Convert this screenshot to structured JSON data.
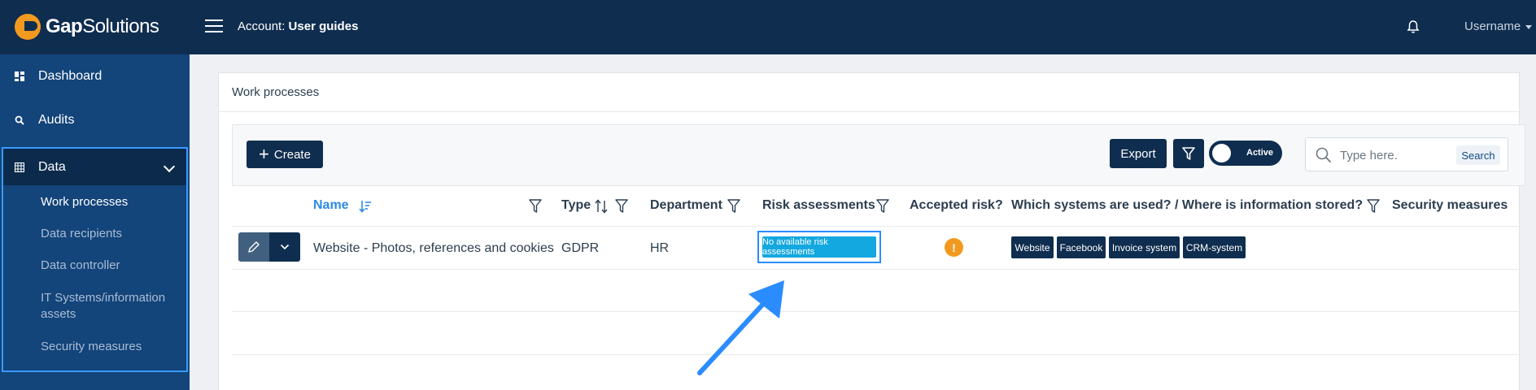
{
  "app": {
    "logo_text_bold": "Gap",
    "logo_text": "Solutions"
  },
  "header": {
    "account_label": "Account:",
    "account_name": "User guides",
    "username": "Username"
  },
  "sidebar": {
    "items": [
      {
        "label": "Dashboard",
        "icon": "dashboard-icon"
      },
      {
        "label": "Audits",
        "icon": "search-icon"
      },
      {
        "label": "Data",
        "icon": "table-icon"
      }
    ],
    "data_subitems": [
      {
        "label": "Work processes",
        "active": true
      },
      {
        "label": "Data recipients",
        "active": false
      },
      {
        "label": "Data controller",
        "active": false
      },
      {
        "label": "IT Systems/information assets",
        "active": false
      },
      {
        "label": "Security measures",
        "active": false
      }
    ]
  },
  "panel": {
    "title": "Work processes"
  },
  "toolbar": {
    "create_label": "Create",
    "export_label": "Export",
    "toggle_label": "Active",
    "search_placeholder": "Type here.",
    "search_button": "Search"
  },
  "table": {
    "columns": [
      "Name",
      "Type",
      "Department",
      "Risk assessments",
      "Accepted risk?",
      "Which systems are used? / Where is information stored?",
      "Security measures"
    ],
    "rows": [
      {
        "name": "Website - Photos, references and cookies",
        "type": "GDPR",
        "department": "HR",
        "risk_assessments": "No available risk assessments",
        "accepted_risk": "!",
        "systems": [
          "Website",
          "Facebook",
          "Invoice system",
          "CRM-system"
        ]
      }
    ]
  },
  "colors": {
    "navy": "#0f2d4f",
    "sidebar": "#13447a",
    "accent": "#2e8ae6",
    "warning": "#f29a1f",
    "badge": "#13a8e0"
  }
}
